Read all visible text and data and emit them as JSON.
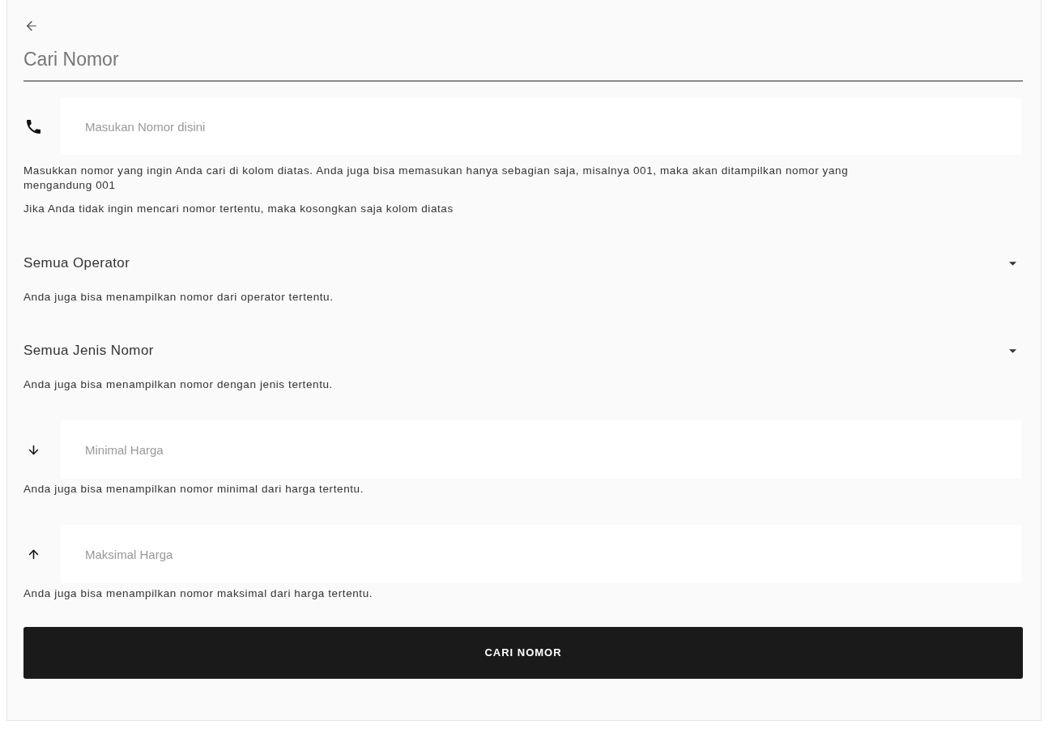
{
  "header": {
    "title": "Cari Nomor"
  },
  "number_field": {
    "placeholder": "Masukan Nomor disini",
    "hints": [
      "Masukkan nomor yang ingin Anda cari di kolom diatas. Anda juga bisa memasukan hanya sebagian saja, misalnya 001, maka akan ditampilkan nomor yang mengandung 001",
      "Jika Anda tidak ingin mencari nomor tertentu, maka kosongkan saja kolom diatas"
    ]
  },
  "selects": [
    {
      "value": "Semua Operator",
      "hint": "Anda juga bisa menampilkan nomor dari operator tertentu."
    },
    {
      "value": "Semua Jenis Nomor",
      "hint": "Anda juga bisa menampilkan nomor dengan jenis tertentu."
    }
  ],
  "price_fields": [
    {
      "kind": "min",
      "placeholder": "Minimal Harga",
      "hint": "Anda juga bisa menampilkan nomor minimal dari harga tertentu."
    },
    {
      "kind": "max",
      "placeholder": "Maksimal Harga",
      "hint": "Anda juga bisa menampilkan nomor maksimal dari harga tertentu."
    }
  ],
  "submit_button": {
    "label": "CARI NOMOR"
  }
}
